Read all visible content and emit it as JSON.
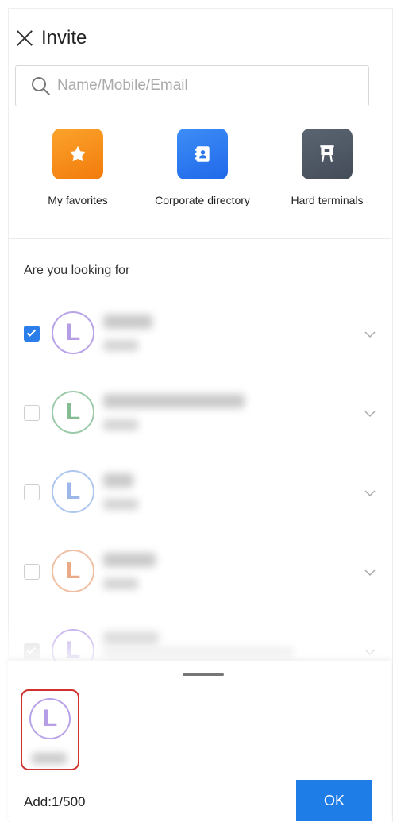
{
  "header": {
    "title": "Invite",
    "close_icon": "close-icon"
  },
  "search": {
    "placeholder": "Name/Mobile/Email",
    "icon": "search-icon"
  },
  "shortcuts": [
    {
      "label": "My favorites",
      "icon": "star-icon",
      "color": "#f5860e"
    },
    {
      "label": "Corporate directory",
      "icon": "contacts-book-icon",
      "color": "#2f7ff0"
    },
    {
      "label": "Hard terminals",
      "icon": "terminal-board-icon",
      "color": "#4b5562"
    }
  ],
  "suggestions": {
    "title": "Are you looking for",
    "contacts": [
      {
        "checked": true,
        "initial": "L",
        "avatar_color": "#9b7fd6"
      },
      {
        "checked": false,
        "initial": "L",
        "avatar_color": "#6bb57d"
      },
      {
        "checked": false,
        "initial": "L",
        "avatar_color": "#8aa8e6"
      },
      {
        "checked": false,
        "initial": "L",
        "avatar_color": "#e99a6c"
      },
      {
        "checked": true,
        "disabled": true,
        "initial": "L",
        "avatar_color": "#9b7fd6"
      }
    ]
  },
  "selection": {
    "selected_initial": "L",
    "selected_avatar_color": "#9b7fd6",
    "highlight_color": "#d0312d",
    "count_text": "Add:1/500",
    "ok_label": "OK"
  },
  "colors": {
    "accent": "#1f7de8"
  }
}
